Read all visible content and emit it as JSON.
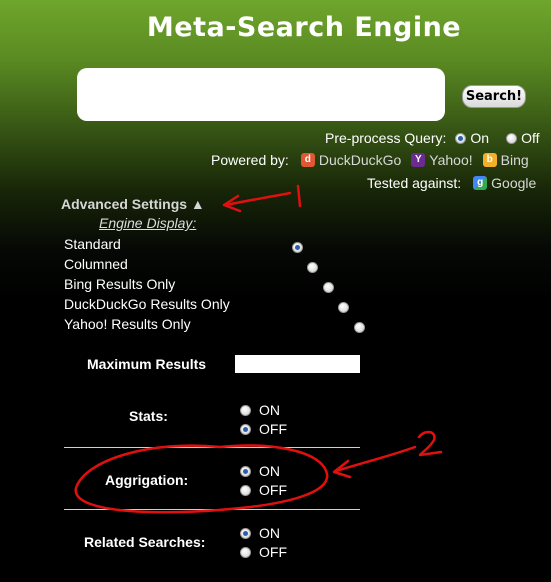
{
  "header": {
    "title": "Meta-Search Engine"
  },
  "search": {
    "value": "",
    "button_label": "Search!"
  },
  "preprocess": {
    "label": "Pre-process Query:",
    "options": [
      "On",
      "Off"
    ],
    "selected": "On"
  },
  "powered_by": {
    "label": "Powered by:",
    "engines": [
      "DuckDuckGo",
      "Yahoo!",
      "Bing"
    ]
  },
  "tested_against": {
    "label": "Tested against:",
    "engine": "Google"
  },
  "advanced": {
    "toggle_label": "Advanced Settings ▲",
    "engine_display_label": "Engine Display:",
    "engine_display_options": [
      "Standard",
      "Columned",
      "Bing Results Only",
      "DuckDuckGo Results Only",
      "Yahoo! Results Only"
    ],
    "engine_display_selected": "Standard",
    "max_results_label": "Maximum Results",
    "max_results_value": "",
    "stats": {
      "label": "Stats:",
      "options": [
        "ON",
        "OFF"
      ],
      "selected": "OFF"
    },
    "aggregation": {
      "label": "Aggrigation:",
      "options": [
        "ON",
        "OFF"
      ],
      "selected": "ON"
    },
    "related": {
      "label": "Related Searches:",
      "options": [
        "ON",
        "OFF"
      ],
      "selected": "ON"
    }
  },
  "annotations": {
    "marker_1": "1",
    "marker_2": "2",
    "color": "#e01010"
  },
  "colors": {
    "accent_radio": "#2b5fa8",
    "bg_top": "#6fa62c",
    "bg_bottom": "#000000",
    "duckduckgo": "#de5833",
    "yahoo": "#6b2c91",
    "bing": "#f2b02a"
  }
}
